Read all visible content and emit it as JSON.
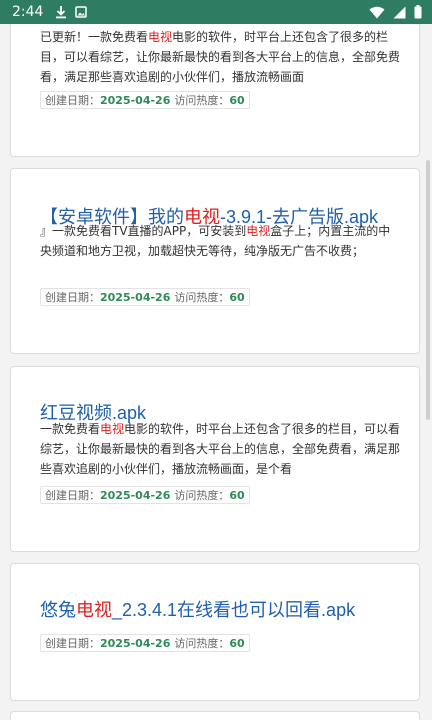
{
  "status_bar": {
    "time": "2:44",
    "icons": [
      "download-icon",
      "photo-icon",
      "wifi-icon",
      "signal-icon",
      "battery-icon"
    ]
  },
  "cards": [
    {
      "desc": "已更新！一款免费看电视电影的软件，时平台上还包含了很多的栏目，可以看综艺，让你最新最快的看到各大平台上的信息，全部免费看，满足那些喜欢追剧的小伙伴们，播放流畅画面",
      "desc_parts": [
        "已更新！一款免费看",
        "电视",
        "电影的软件，时平台上还包含了很多的栏目，可以看综艺，让你最新最快的看到各大平台上的信息，全部免费看，满足那些喜欢追剧的小伙伴们，播放流畅画面"
      ],
      "date_label": "创建日期：",
      "date": "2025-04-26",
      "heat_label": "访问热度：",
      "heat": "60"
    },
    {
      "title_parts": [
        "【安卓软件】我的",
        "电视",
        "-3.9.1-去广告版.apk"
      ],
      "desc_parts": [
        "』一款免费看TV直播的APP，可安装到",
        "电视",
        "盒子上；内置主流的中央频道和地方卫视，加载超快无等待，纯净版无广告不收费；"
      ],
      "date_label": "创建日期：",
      "date": "2025-04-26",
      "heat_label": "访问热度：",
      "heat": "60"
    },
    {
      "title_parts": [
        "红豆视频.apk"
      ],
      "desc_parts": [
        "一款免费看",
        "电视",
        "电影的软件，时平台上还包含了很多的栏目，可以看综艺，让你最新最快的看到各大平台上的信息，全部免费看，满足那些喜欢追剧的小伙伴们，播放流畅画面，是个看"
      ],
      "date_label": "创建日期：",
      "date": "2025-04-26",
      "heat_label": "访问热度：",
      "heat": "60"
    },
    {
      "title_parts": [
        "悠兔",
        "电视",
        "_2.3.4.1在线看也可以回看.apk"
      ],
      "date_label": "创建日期：",
      "date": "2025-04-26",
      "heat_label": "访问热度：",
      "heat": "60"
    }
  ]
}
